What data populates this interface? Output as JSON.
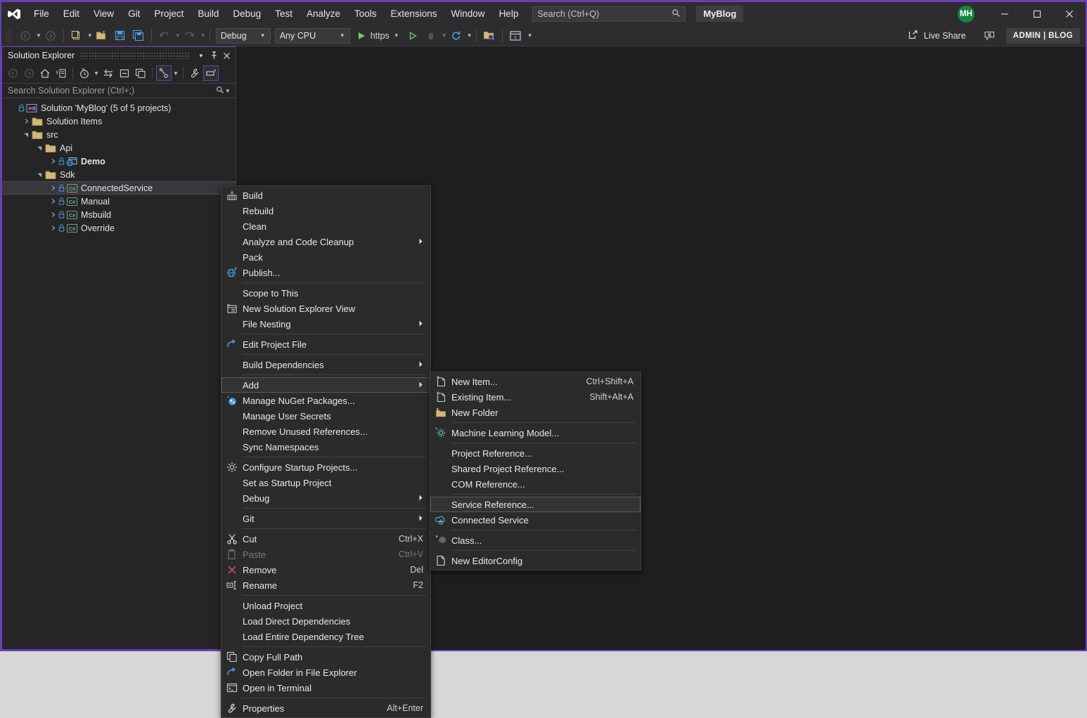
{
  "window": {
    "title_chip": "MyBlog",
    "accent_border": "#6a3fb5",
    "bg": "#1e1e1e"
  },
  "menubar": {
    "items": [
      {
        "label": "File"
      },
      {
        "label": "Edit"
      },
      {
        "label": "View"
      },
      {
        "label": "Git"
      },
      {
        "label": "Project"
      },
      {
        "label": "Build"
      },
      {
        "label": "Debug"
      },
      {
        "label": "Test"
      },
      {
        "label": "Analyze"
      },
      {
        "label": "Tools"
      },
      {
        "label": "Extensions"
      },
      {
        "label": "Window"
      },
      {
        "label": "Help"
      }
    ]
  },
  "search": {
    "placeholder": "Search (Ctrl+Q)",
    "icon": "search-icon"
  },
  "account": {
    "initials": "MH",
    "color": "#17873f"
  },
  "window_controls": {
    "minimize": "—",
    "maximize": "☐",
    "close": "✕"
  },
  "toolbar": {
    "configuration": "Debug",
    "platform": "Any CPU",
    "run_target": "https",
    "live_share": "Live Share",
    "admin_chip": "ADMIN | BLOG"
  },
  "solution_explorer": {
    "title": "Solution Explorer",
    "search_placeholder": "Search Solution Explorer (Ctrl+;)",
    "tree": [
      {
        "label": "Solution 'MyBlog' (5 of 5 projects)",
        "indent": 0,
        "arrow": "none",
        "icon": "solution-icon",
        "lock": true,
        "bold": false,
        "selected": false
      },
      {
        "label": "Solution Items",
        "indent": 1,
        "arrow": "collapsed",
        "icon": "folder-icon",
        "lock": false,
        "bold": false,
        "selected": false
      },
      {
        "label": "src",
        "indent": 1,
        "arrow": "expanded",
        "icon": "folder-icon",
        "lock": false,
        "bold": false,
        "selected": false
      },
      {
        "label": "Api",
        "indent": 2,
        "arrow": "expanded",
        "icon": "folder-icon",
        "lock": false,
        "bold": false,
        "selected": false
      },
      {
        "label": "Demo",
        "indent": 3,
        "arrow": "collapsed",
        "icon": "web-project-icon",
        "lock": true,
        "bold": true,
        "selected": false
      },
      {
        "label": "Sdk",
        "indent": 2,
        "arrow": "expanded",
        "icon": "folder-icon",
        "lock": false,
        "bold": false,
        "selected": false
      },
      {
        "label": "ConnectedService",
        "indent": 3,
        "arrow": "collapsed",
        "icon": "csharp-project-icon",
        "lock": true,
        "bold": false,
        "selected": true
      },
      {
        "label": "Manual",
        "indent": 3,
        "arrow": "collapsed",
        "icon": "csharp-project-icon",
        "lock": true,
        "bold": false,
        "selected": false
      },
      {
        "label": "Msbuild",
        "indent": 3,
        "arrow": "collapsed",
        "icon": "csharp-project-icon",
        "lock": true,
        "bold": false,
        "selected": false
      },
      {
        "label": "Override",
        "indent": 3,
        "arrow": "collapsed",
        "icon": "csharp-project-icon",
        "lock": true,
        "bold": false,
        "selected": false
      }
    ]
  },
  "context_menu": {
    "items": [
      {
        "label": "Build",
        "icon": "build-icon"
      },
      {
        "label": "Rebuild",
        "icon": "none"
      },
      {
        "label": "Clean",
        "icon": "none"
      },
      {
        "label": "Analyze and Code Cleanup",
        "icon": "none",
        "submenu": true
      },
      {
        "label": "Pack",
        "icon": "none"
      },
      {
        "label": "Publish...",
        "icon": "publish-globe-icon"
      },
      {
        "separator": true
      },
      {
        "label": "Scope to This",
        "icon": "none"
      },
      {
        "label": "New Solution Explorer View",
        "icon": "new-view-icon"
      },
      {
        "label": "File Nesting",
        "icon": "none",
        "submenu": true
      },
      {
        "separator": true
      },
      {
        "label": "Edit Project File",
        "icon": "edit-project-icon"
      },
      {
        "separator": true
      },
      {
        "label": "Build Dependencies",
        "icon": "none",
        "submenu": true
      },
      {
        "separator": true
      },
      {
        "label": "Add",
        "icon": "none",
        "submenu": true,
        "highlighted": true
      },
      {
        "label": "Manage NuGet Packages...",
        "icon": "nuget-icon"
      },
      {
        "label": "Manage User Secrets",
        "icon": "none"
      },
      {
        "label": "Remove Unused References...",
        "icon": "none"
      },
      {
        "label": "Sync Namespaces",
        "icon": "none"
      },
      {
        "separator": true
      },
      {
        "label": "Configure Startup Projects...",
        "icon": "gear-icon"
      },
      {
        "label": "Set as Startup Project",
        "icon": "none"
      },
      {
        "label": "Debug",
        "icon": "none",
        "submenu": true
      },
      {
        "separator": true
      },
      {
        "label": "Git",
        "icon": "none",
        "submenu": true
      },
      {
        "separator": true
      },
      {
        "label": "Cut",
        "icon": "cut-icon",
        "shortcut": "Ctrl+X"
      },
      {
        "label": "Paste",
        "icon": "paste-icon",
        "shortcut": "Ctrl+V",
        "disabled": true
      },
      {
        "label": "Remove",
        "icon": "remove-x-icon",
        "shortcut": "Del"
      },
      {
        "label": "Rename",
        "icon": "rename-icon",
        "shortcut": "F2"
      },
      {
        "separator": true
      },
      {
        "label": "Unload Project",
        "icon": "none"
      },
      {
        "label": "Load Direct Dependencies",
        "icon": "none"
      },
      {
        "label": "Load Entire Dependency Tree",
        "icon": "none"
      },
      {
        "separator": true
      },
      {
        "label": "Copy Full Path",
        "icon": "copy-icon"
      },
      {
        "label": "Open Folder in File Explorer",
        "icon": "open-folder-arrow-icon"
      },
      {
        "label": "Open in Terminal",
        "icon": "terminal-icon"
      },
      {
        "separator": true
      },
      {
        "label": "Properties",
        "icon": "wrench-icon",
        "shortcut": "Alt+Enter"
      }
    ]
  },
  "add_submenu": {
    "items": [
      {
        "label": "New Item...",
        "icon": "new-item-icon",
        "shortcut": "Ctrl+Shift+A"
      },
      {
        "label": "Existing Item...",
        "icon": "existing-item-icon",
        "shortcut": "Shift+Alt+A"
      },
      {
        "label": "New Folder",
        "icon": "new-folder-icon"
      },
      {
        "separator": true
      },
      {
        "label": "Machine Learning Model...",
        "icon": "ml-model-icon"
      },
      {
        "separator": true
      },
      {
        "label": "Project Reference...",
        "icon": "none"
      },
      {
        "label": "Shared Project Reference...",
        "icon": "none"
      },
      {
        "label": "COM Reference...",
        "icon": "none"
      },
      {
        "separator": true
      },
      {
        "label": "Service Reference...",
        "icon": "none",
        "highlighted": true
      },
      {
        "label": "Connected Service",
        "icon": "connected-service-icon"
      },
      {
        "separator": true
      },
      {
        "label": "Class...",
        "icon": "class-icon"
      },
      {
        "separator": true
      },
      {
        "label": "New EditorConfig",
        "icon": "editorconfig-icon"
      }
    ]
  }
}
